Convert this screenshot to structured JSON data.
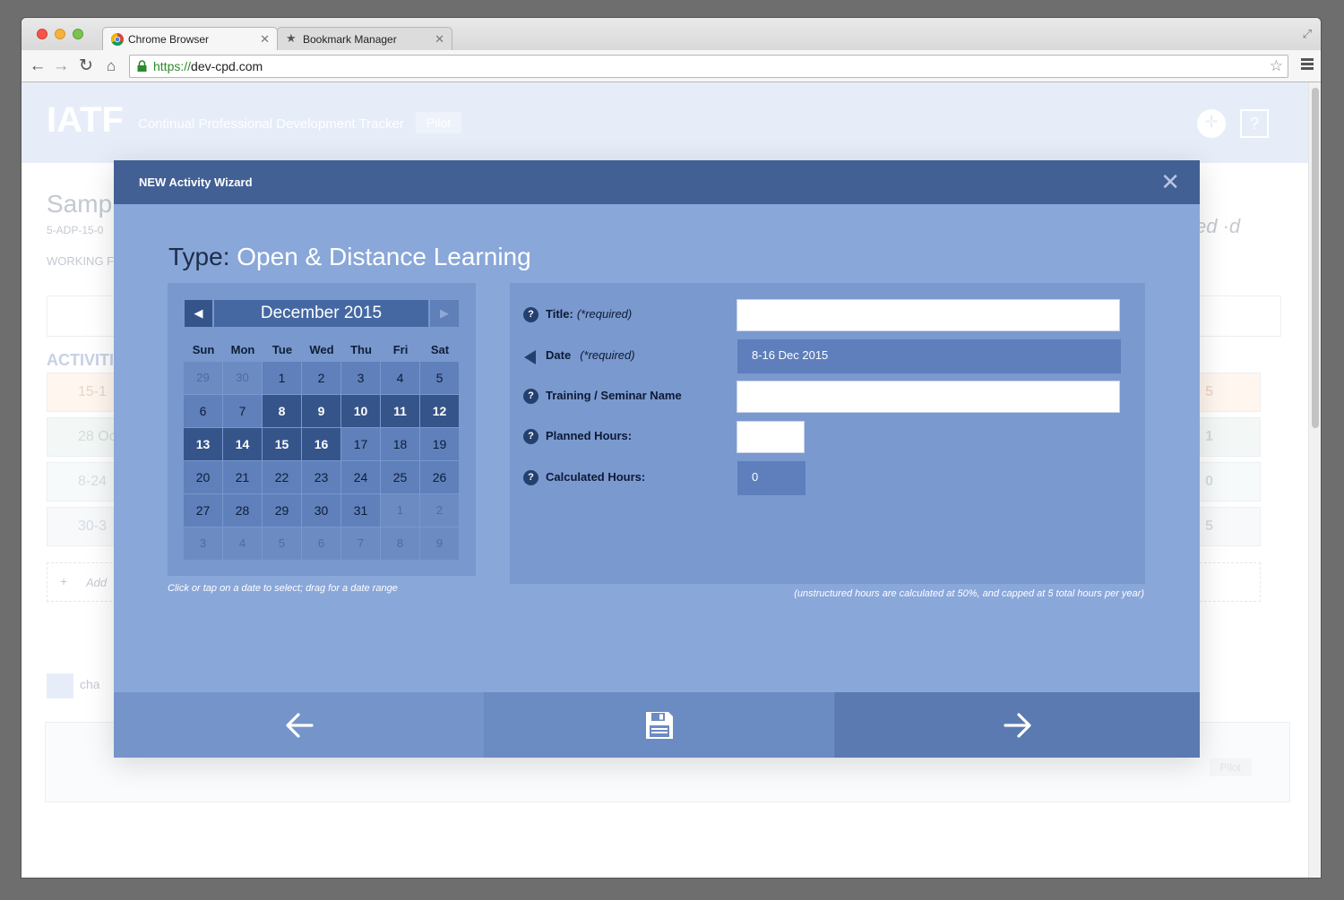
{
  "browser": {
    "tabs": [
      {
        "label": "Chrome Browser"
      },
      {
        "label": "Bookmark Manager"
      }
    ],
    "url_scheme": "https://",
    "url_host": "dev-cpd.com"
  },
  "background_page": {
    "brand": "IATF",
    "subtitle": "Continual Professional Development Tracker",
    "badge": "Pilot",
    "heading_fragment": "Samp",
    "ref_fragment": "5-ADP-15-0",
    "working_fragment": "WORKING F",
    "right_heading_fragment": "ed ·d",
    "activities_label": "ACTIVITI",
    "rows": [
      {
        "label": "15-1",
        "value": "5"
      },
      {
        "label": "28 Oc",
        "value": "1"
      },
      {
        "label": "8-24",
        "value": "0"
      },
      {
        "label": "30-3",
        "value": "5"
      }
    ],
    "add_label": "Add",
    "cha_label": "cha",
    "pilot_small": "Pilot"
  },
  "modal": {
    "title": "NEW Activity Wizard",
    "type_label": "Type:",
    "type_value": "Open & Distance Learning",
    "calendar": {
      "month": "December 2015",
      "weekdays": [
        "Sun",
        "Mon",
        "Tue",
        "Wed",
        "Thu",
        "Fri",
        "Sat"
      ],
      "days": [
        {
          "d": "29",
          "o": true
        },
        {
          "d": "30",
          "o": true
        },
        {
          "d": "1"
        },
        {
          "d": "2"
        },
        {
          "d": "3"
        },
        {
          "d": "4"
        },
        {
          "d": "5"
        },
        {
          "d": "6"
        },
        {
          "d": "7"
        },
        {
          "d": "8",
          "s": true
        },
        {
          "d": "9",
          "s": true
        },
        {
          "d": "10",
          "s": true
        },
        {
          "d": "11",
          "s": true
        },
        {
          "d": "12",
          "s": true
        },
        {
          "d": "13",
          "s": true
        },
        {
          "d": "14",
          "s": true
        },
        {
          "d": "15",
          "s": true
        },
        {
          "d": "16",
          "s": true
        },
        {
          "d": "17"
        },
        {
          "d": "18"
        },
        {
          "d": "19"
        },
        {
          "d": "20"
        },
        {
          "d": "21"
        },
        {
          "d": "22"
        },
        {
          "d": "23"
        },
        {
          "d": "24"
        },
        {
          "d": "25"
        },
        {
          "d": "26"
        },
        {
          "d": "27"
        },
        {
          "d": "28"
        },
        {
          "d": "29"
        },
        {
          "d": "30"
        },
        {
          "d": "31"
        },
        {
          "d": "1",
          "o": true
        },
        {
          "d": "2",
          "o": true
        },
        {
          "d": "3",
          "o": true
        },
        {
          "d": "4",
          "o": true
        },
        {
          "d": "5",
          "o": true
        },
        {
          "d": "6",
          "o": true
        },
        {
          "d": "7",
          "o": true
        },
        {
          "d": "8",
          "o": true
        },
        {
          "d": "9",
          "o": true
        }
      ],
      "hint": "Click or tap on a date to select; drag for a date range"
    },
    "form": {
      "title_label": "Title:",
      "title_required": "(*required)",
      "title_value": "",
      "date_label": "Date",
      "date_required": "(*required)",
      "date_value": "8-16 Dec 2015",
      "seminar_label": "Training / Seminar Name",
      "seminar_value": "",
      "planned_label": "Planned Hours:",
      "planned_value": "",
      "calculated_label": "Calculated Hours:",
      "calculated_value": "0",
      "note": "(unstructured hours are calculated at 50%, and capped at 5 total hours per year)"
    }
  },
  "colors": {
    "modal_header": "#426094",
    "modal_body": "#89a7d9",
    "selected_day": "#35548a"
  }
}
